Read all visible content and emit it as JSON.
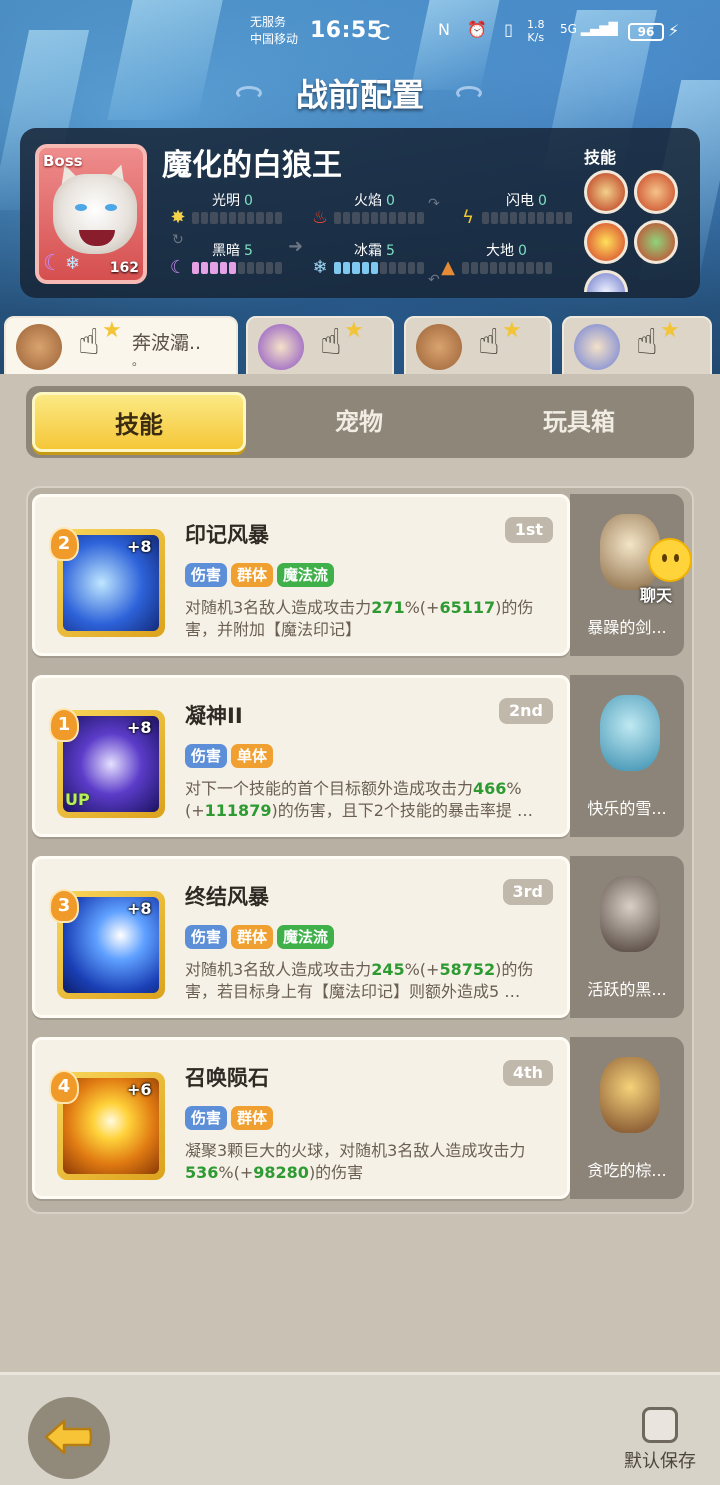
{
  "status_bar": {
    "carrier_line1": "无服务",
    "carrier_line2": "中国移动",
    "time": "16:55",
    "icons": "N ⏰ ▯",
    "speed_value": "1.8",
    "speed_unit": "K/s",
    "signal": "5G",
    "battery": "96"
  },
  "page_title": "战前配置",
  "boss": {
    "tag": "Boss",
    "name": "魔化的白狼王",
    "level": "162",
    "elements": [
      {
        "name": "光明",
        "value": "0",
        "icon": "sun-icon",
        "fill": 0
      },
      {
        "name": "火焰",
        "value": "0",
        "icon": "flame-icon",
        "fill": 0
      },
      {
        "name": "闪电",
        "value": "0",
        "icon": "lightning-icon",
        "fill": 0
      },
      {
        "name": "黑暗",
        "value": "5",
        "icon": "moon-icon",
        "fill": 5
      },
      {
        "name": "冰霜",
        "value": "5",
        "icon": "snowflake-icon",
        "fill": 5
      },
      {
        "name": "大地",
        "value": "0",
        "icon": "earth-icon",
        "fill": 0
      }
    ],
    "skills_label": "技能"
  },
  "hero_tabs": [
    {
      "name": "奔波灞..",
      "name_line2": "。",
      "active": true
    },
    {
      "name": "",
      "active": false
    },
    {
      "name": "",
      "active": false
    },
    {
      "name": "",
      "active": false
    }
  ],
  "segments": {
    "skills": "技能",
    "pets": "宠物",
    "toybox": "玩具箱",
    "active": "skills"
  },
  "skills": [
    {
      "order": "2",
      "plus": "+8",
      "title": "印记风暴",
      "rank": "1st",
      "tags": [
        "伤害",
        "群体",
        "魔法流"
      ],
      "desc_a": "对随机3名敌人造成攻击力",
      "desc_g1": "271",
      "desc_b": "%(+",
      "desc_g2": "65117",
      "desc_c": ")的伤害，并附加【魔法印记】",
      "up": ""
    },
    {
      "order": "1",
      "plus": "+8",
      "title": "凝神II",
      "rank": "2nd",
      "tags": [
        "伤害",
        "单体"
      ],
      "desc_a": "对下一个技能的首个目标额外造成攻击力",
      "desc_g1": "466",
      "desc_b": "%(+",
      "desc_g2": "111879",
      "desc_c": ")的伤害，且下2个技能的暴击率提 …",
      "up": "UP"
    },
    {
      "order": "3",
      "plus": "+8",
      "title": "终结风暴",
      "rank": "3rd",
      "tags": [
        "伤害",
        "群体",
        "魔法流"
      ],
      "desc_a": "对随机3名敌人造成攻击力",
      "desc_g1": "245",
      "desc_b": "%(+",
      "desc_g2": "58752",
      "desc_c": ")的伤害，若目标身上有【魔法印记】则额外造成5 …",
      "up": ""
    },
    {
      "order": "4",
      "plus": "+6",
      "title": "召唤陨石",
      "rank": "4th",
      "tags": [
        "伤害",
        "群体"
      ],
      "desc_a": "凝聚3颗巨大的火球，对随机3名敌人造成攻击力",
      "desc_g1": "536",
      "desc_b": "%(+",
      "desc_g2": "98280",
      "desc_c": ")的伤害",
      "up": ""
    }
  ],
  "pets": [
    {
      "name": "暴躁的剑..."
    },
    {
      "name": "快乐的雪..."
    },
    {
      "name": "活跃的黑..."
    },
    {
      "name": "贪吃的棕..."
    }
  ],
  "chat_label": "聊天",
  "bottom": {
    "save_label": "默认保存"
  }
}
